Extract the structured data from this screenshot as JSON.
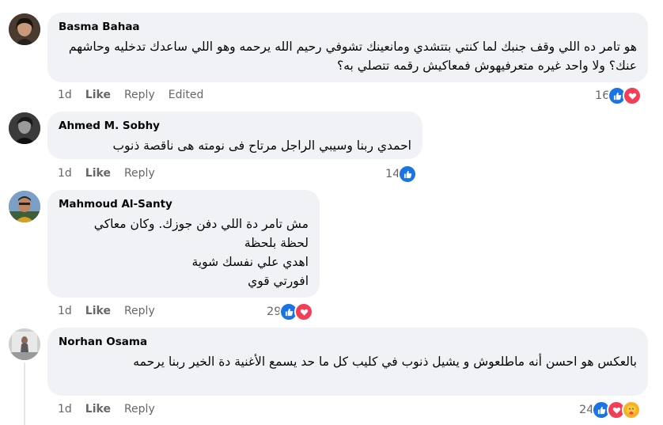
{
  "comments": [
    {
      "author": "Basma Bahaa",
      "text": "هو تامر ده اللي وقف جنبك لما كنتي بتتشدي ومانعينك تشوفي رحيم الله يرحمه وهو اللي ساعدك تدخليه وحاشهم عنك؟ ولا واحد غيره متعرفيهوش فمعاكيش رقمه تتصلي به؟",
      "time": "1d",
      "like": "Like",
      "reply": "Reply",
      "edited": "Edited",
      "reaction_count": "16",
      "reactions": [
        "like-icon",
        "love-icon"
      ]
    },
    {
      "author": "Ahmed M. Sobhy",
      "text": "احمدي ربنا وسيبي الراجل مرتاح فى نومته هى ناقصة ذنوب",
      "time": "1d",
      "like": "Like",
      "reply": "Reply",
      "reaction_count": "14",
      "reactions": [
        "like-icon"
      ]
    },
    {
      "author": "Mahmoud Al-Santy",
      "text": "مش تامر دة اللي دفن جوزك. وكان معاكي\nلحظة بلحظة\nاهدي علي نفسك شوية\nافورتي قوي",
      "time": "1d",
      "like": "Like",
      "reply": "Reply",
      "reaction_count": "29",
      "reactions": [
        "like-icon",
        "love-icon"
      ]
    },
    {
      "author": "Norhan Osama",
      "text": "بالعكس هو احسن أنه ماطلعوش و يشيل ذنوب في كليب كل ما حد يسمع الأغنية دة الخير ربنا يرحمه",
      "time": "1d",
      "like": "Like",
      "reply": "Reply",
      "reaction_count": "24",
      "reactions": [
        "like-icon",
        "love-icon",
        "care-icon"
      ]
    }
  ],
  "colors": {
    "bubble": "#f0f2f5",
    "like": "#1b74e4",
    "love": "#f33e58",
    "care": "#f7b125",
    "meta": "#65676b"
  }
}
